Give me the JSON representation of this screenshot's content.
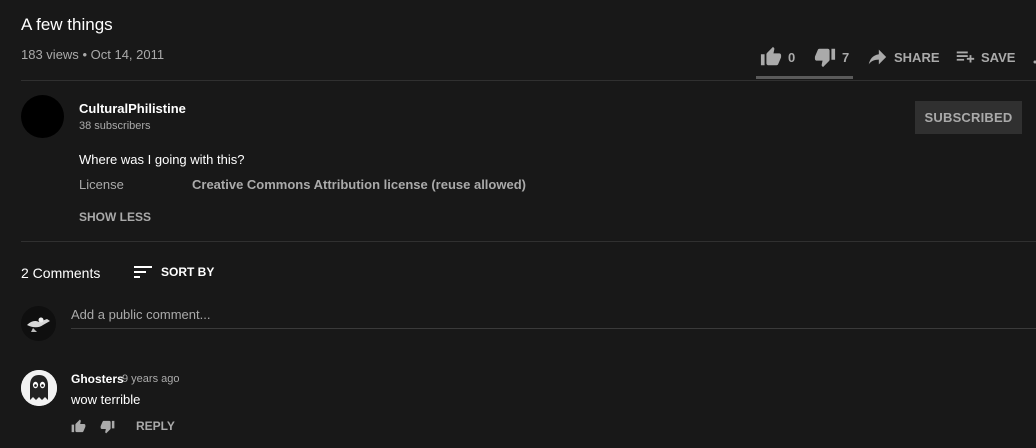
{
  "video": {
    "title": "A few things",
    "views": "183 views",
    "separator": "•",
    "date": "Oct 14, 2011"
  },
  "actions": {
    "likes": "0",
    "dislikes": "7",
    "share_label": "SHARE",
    "save_label": "SAVE",
    "like_ratio": 0
  },
  "channel": {
    "name": "CulturalPhilistine",
    "subscribers": "38 subscribers",
    "subscribe_label": "SUBSCRIBED"
  },
  "description": {
    "text": "Where was I going with this?",
    "license_label": "License",
    "license_value": "Creative Commons Attribution license (reuse allowed)",
    "show_less_label": "SHOW LESS"
  },
  "comments": {
    "count_label": "2 Comments",
    "sort_label": "SORT BY",
    "placeholder": "Add a public comment...",
    "items": [
      {
        "author": "Ghosters",
        "time": "9 years ago",
        "text": "wow terrible",
        "reply_label": "REPLY"
      }
    ]
  },
  "icons": {
    "like": "thumb-up-icon",
    "dislike": "thumb-down-icon",
    "share": "share-arrow-icon",
    "save": "playlist-add-icon",
    "sort": "sort-lines-icon"
  },
  "colors": {
    "background": "#181818",
    "text_primary": "#ffffff",
    "text_secondary": "#aaaaaa",
    "divider": "#303030",
    "subscribed_button_bg": "#303030"
  }
}
